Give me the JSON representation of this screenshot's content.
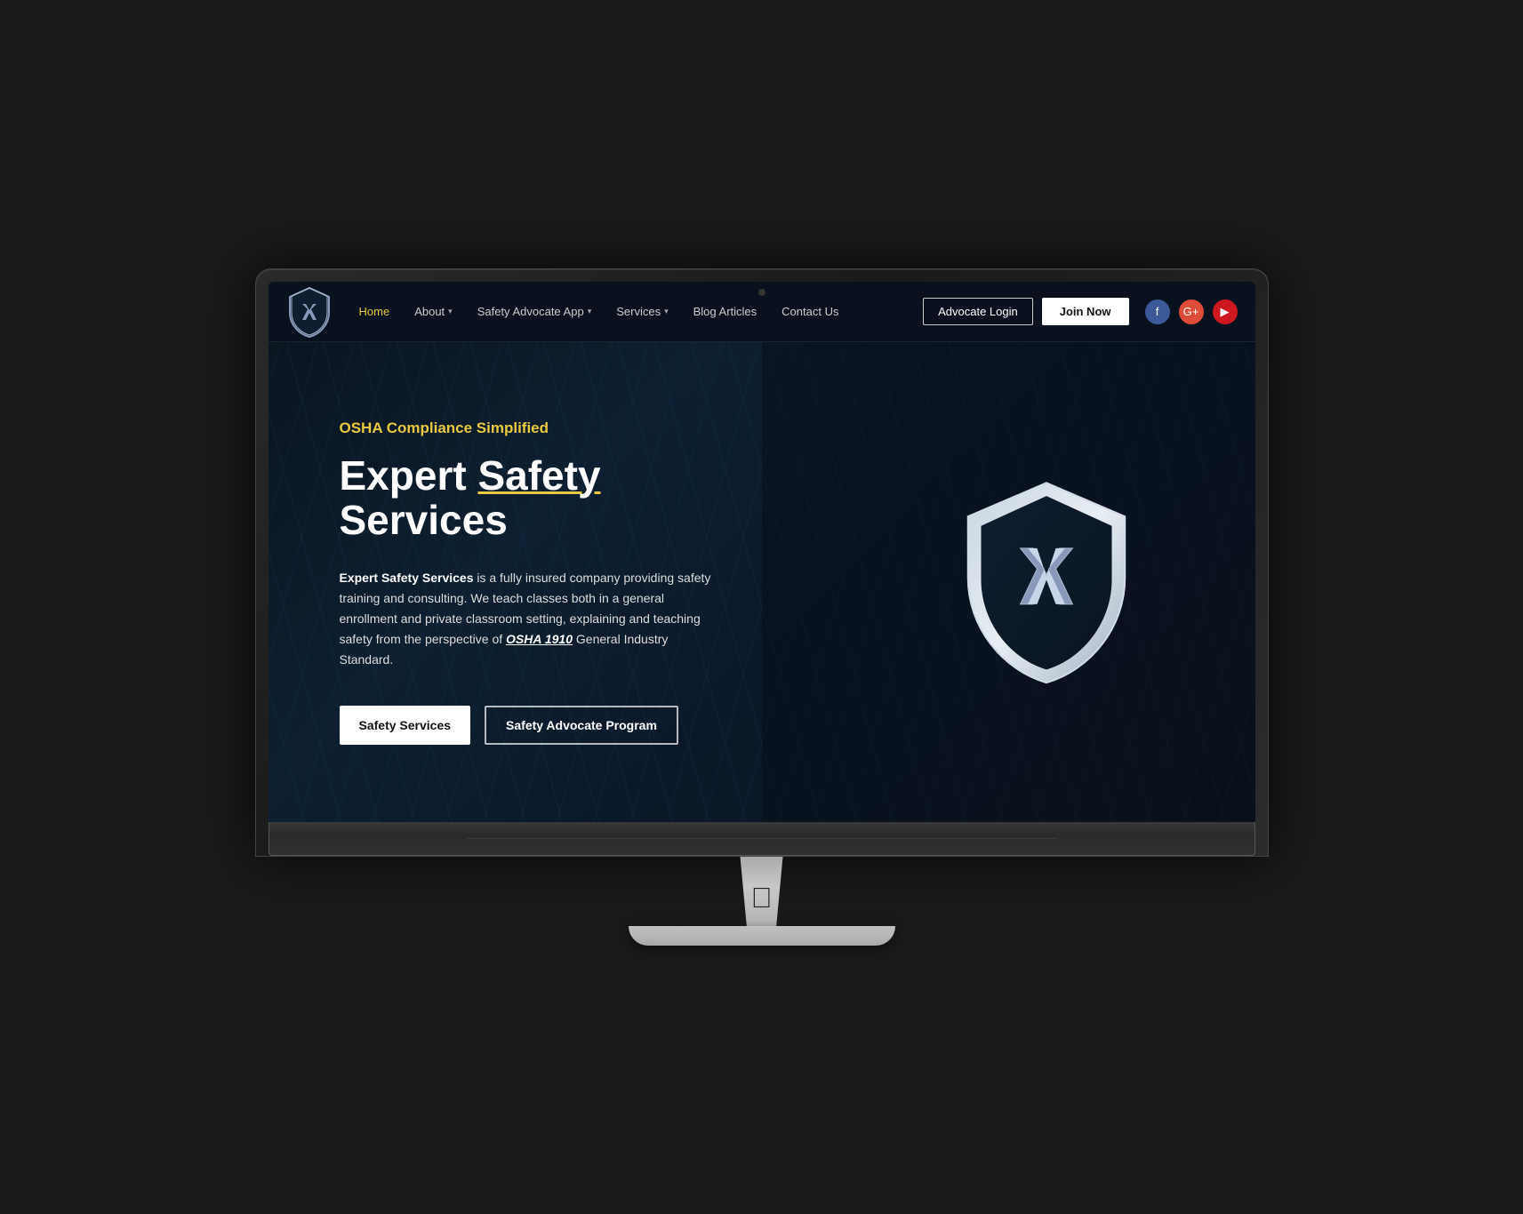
{
  "navbar": {
    "logo_alt": "Expert Safety Services Logo",
    "nav_items": [
      {
        "label": "Home",
        "active": true,
        "has_dropdown": false
      },
      {
        "label": "About",
        "active": false,
        "has_dropdown": true
      },
      {
        "label": "Safety Advocate App",
        "active": false,
        "has_dropdown": true
      },
      {
        "label": "Services",
        "active": false,
        "has_dropdown": true
      },
      {
        "label": "Blog Articles",
        "active": false,
        "has_dropdown": false
      },
      {
        "label": "Contact Us",
        "active": false,
        "has_dropdown": false
      }
    ],
    "advocate_login_label": "Advocate Login",
    "join_now_label": "Join Now",
    "social": {
      "facebook": "f",
      "gplus": "G+",
      "youtube": "▶"
    }
  },
  "hero": {
    "tagline": "OSHA Compliance Simplified",
    "title_line1": "Expert ",
    "title_underline": "Safety",
    "title_line2": " Services",
    "description_bold": "Expert Safety Services",
    "description_text": " is a fully insured company providing safety training and consulting. We teach classes both in a general enrollment and private classroom setting, explaining and teaching safety from the perspective of ",
    "description_osha": "OSHA 1910",
    "description_end": " General Industry Standard.",
    "btn_safety_services": "Safety Services",
    "btn_safety_advocate": "Safety Advocate Program"
  }
}
